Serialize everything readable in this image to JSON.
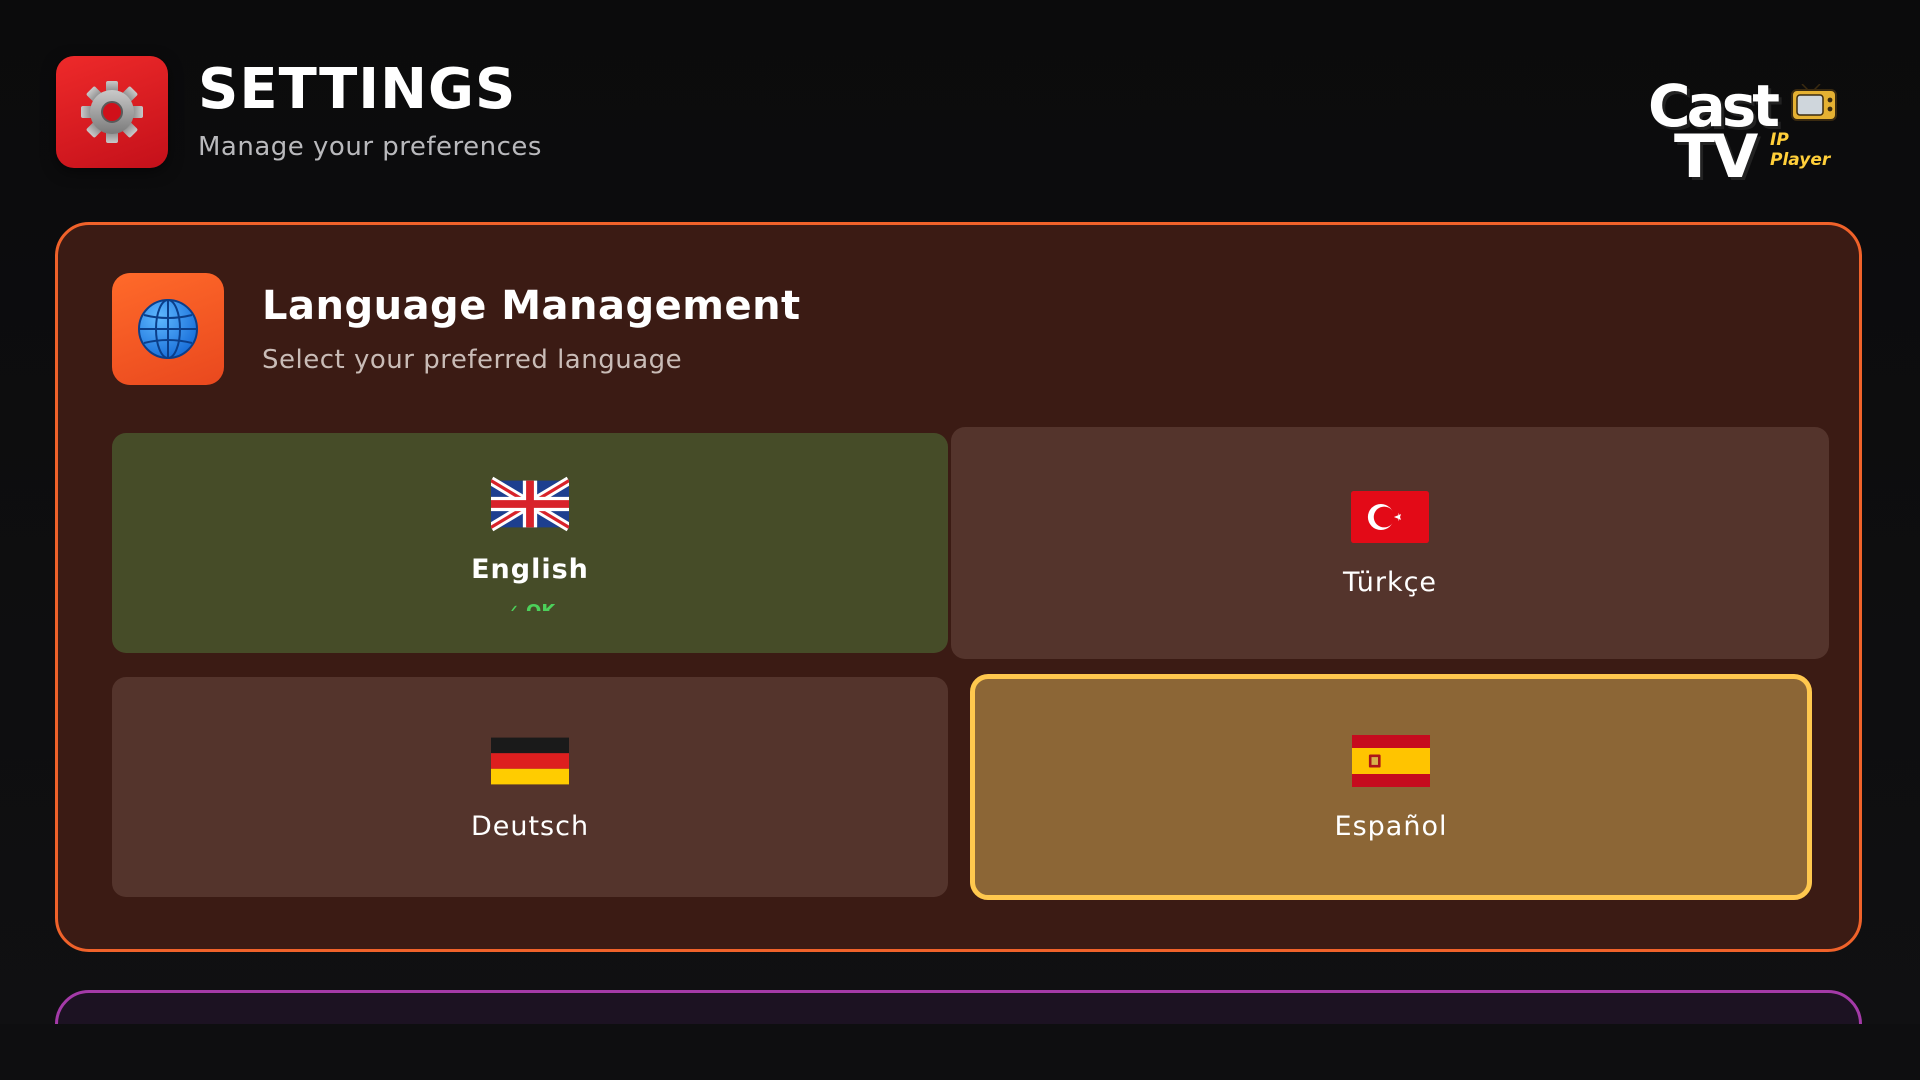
{
  "header": {
    "title": "SETTINGS",
    "subtitle": "Manage your preferences",
    "icon": "gear-icon"
  },
  "logo": {
    "word1": "Cast",
    "word2": "TV",
    "tagline": "IP Player"
  },
  "language_panel": {
    "title": "Language Management",
    "subtitle": "Select your preferred language",
    "icon": "globe-icon",
    "accent_color": "#f0622a",
    "options": [
      {
        "label": "English",
        "flag": "uk-flag-icon",
        "status": "✓ OK",
        "active": true
      },
      {
        "label": "Türkçe",
        "flag": "turkey-flag-icon"
      },
      {
        "label": "Deutsch",
        "flag": "germany-flag-icon"
      },
      {
        "label": "Español",
        "flag": "spain-flag-icon",
        "focused": true
      }
    ]
  },
  "colors": {
    "active_card": "#464c28",
    "focused_border": "#ffc84e",
    "ok_green": "#4cd05a",
    "next_panel_border": "#a43aa8"
  }
}
